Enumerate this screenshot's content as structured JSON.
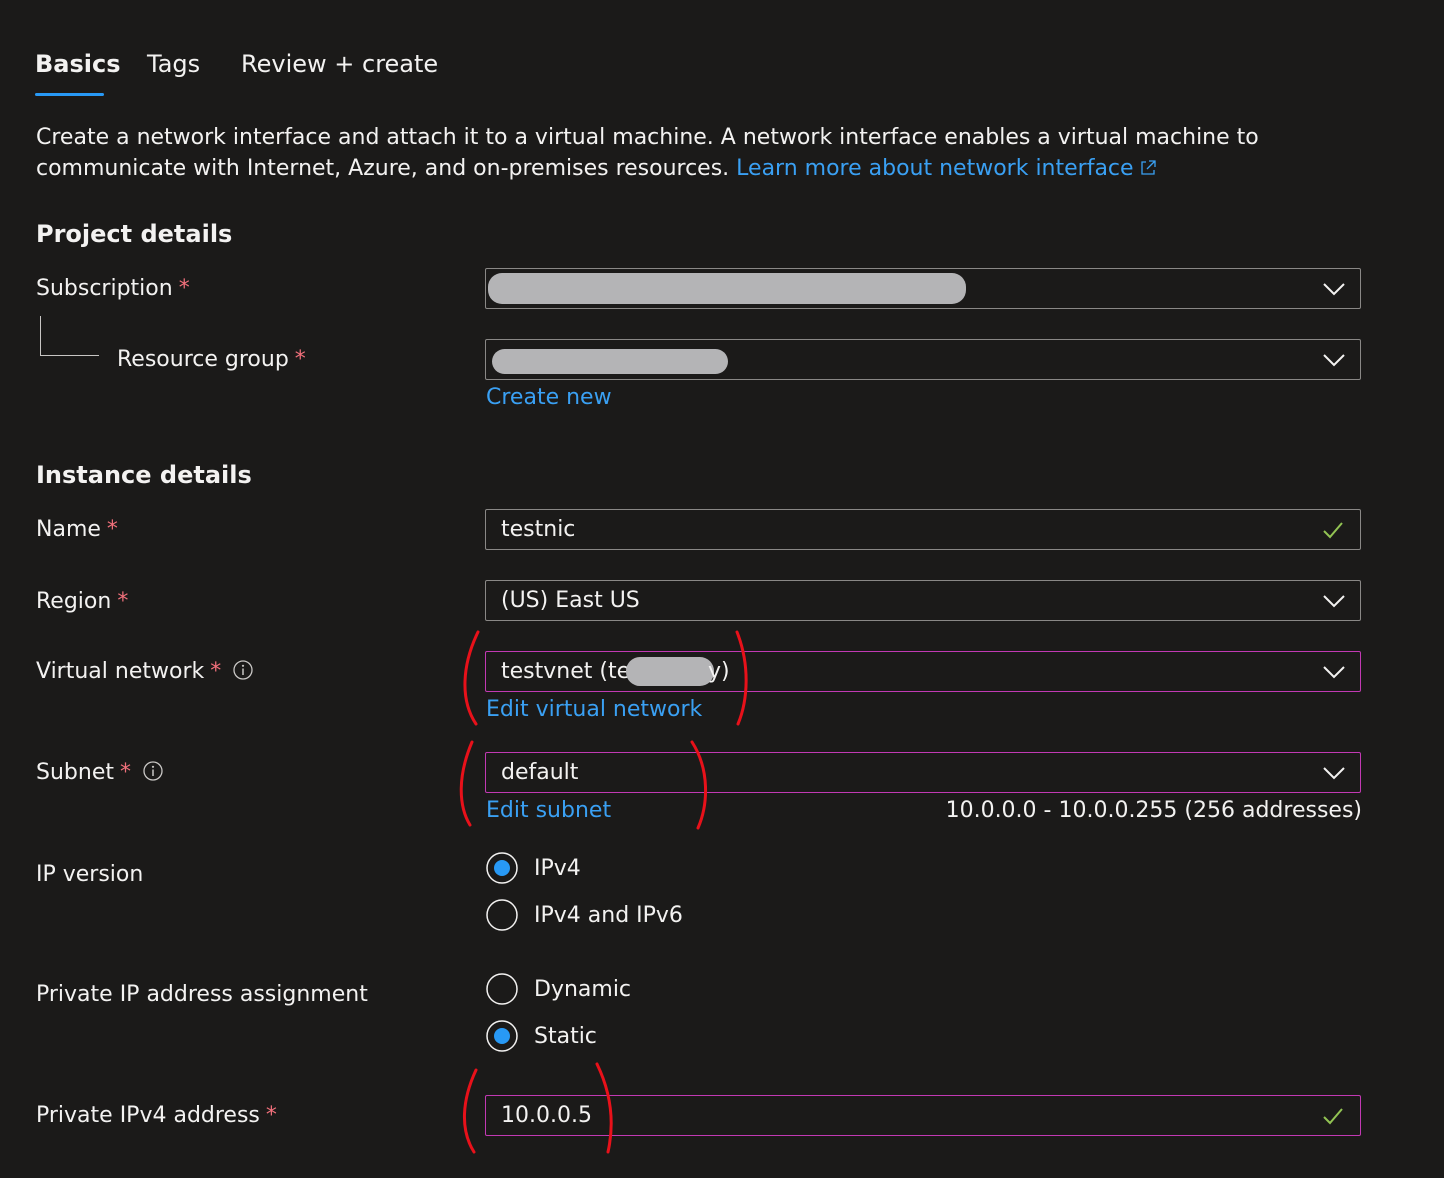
{
  "tabs": [
    {
      "label": "Basics",
      "active": true
    },
    {
      "label": "Tags",
      "active": false
    },
    {
      "label": "Review + create",
      "active": false
    }
  ],
  "description": {
    "text": "Create a network interface and attach it to a virtual machine. A network interface enables a virtual machine to communicate with Internet, Azure, and on-premises resources.",
    "link": "Learn more about network interface"
  },
  "project_details": {
    "title": "Project details",
    "subscription": {
      "label": "Subscription",
      "required": "*"
    },
    "resource_group": {
      "label": "Resource group",
      "required": "*",
      "create_new": "Create new"
    }
  },
  "instance_details": {
    "title": "Instance details",
    "name": {
      "label": "Name",
      "required": "*",
      "value": "testnic"
    },
    "region": {
      "label": "Region",
      "required": "*",
      "value": "(US) East US"
    },
    "virtual_network": {
      "label": "Virtual network",
      "required": "*",
      "value_start": "testvnet (tes",
      "value_end": "y)",
      "edit_link": "Edit virtual network"
    },
    "subnet": {
      "label": "Subnet",
      "required": "*",
      "value": "default",
      "edit_link": "Edit subnet",
      "range": "10.0.0.0 - 10.0.0.255 (256 addresses)"
    },
    "ip_version": {
      "label": "IP version",
      "options": [
        "IPv4",
        "IPv4 and IPv6"
      ],
      "selected": "IPv4"
    },
    "private_ip_assignment": {
      "label": "Private IP address assignment",
      "options": [
        "Dynamic",
        "Static"
      ],
      "selected": "Static"
    },
    "private_ipv4": {
      "label": "Private IPv4 address",
      "required": "*",
      "value": "10.0.0.5"
    }
  },
  "icons": {
    "dropdown": "chevron-down-icon",
    "valid": "checkmark-icon",
    "info": "info-icon",
    "external": "external-link-icon"
  },
  "colors": {
    "background": "#1b1a19",
    "accent": "#2899f5",
    "link": "#3aa0f3",
    "required": "#f1707b",
    "focus_border": "#c239b3",
    "valid": "#92c353",
    "annotation": "#e8111a"
  }
}
